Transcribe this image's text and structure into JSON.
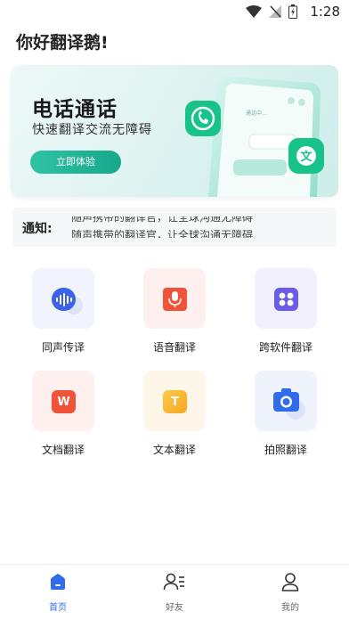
{
  "status_bar": {
    "time": "1:28"
  },
  "header": {
    "greeting": "你好翻译鹅!"
  },
  "banner": {
    "title": "电话通话",
    "subtitle": "快速翻译交流无障碍",
    "button_label": "立即体验",
    "chat_text": "通话中...",
    "badge_letter": "文"
  },
  "notice": {
    "label": "通知:",
    "line1": "随声携带的翻译官，让全球沟通无障碍",
    "line2": "随声携带的翻译官，让全球沟通无障碍"
  },
  "features": [
    {
      "label": "同声传译",
      "icon": "soundwave-icon",
      "color": "#3a63e8"
    },
    {
      "label": "语音翻译",
      "icon": "microphone-icon",
      "color": "#f0523a"
    },
    {
      "label": "跨软件翻译",
      "icon": "apps-grid-icon",
      "color": "#6a5ce8"
    },
    {
      "label": "文档翻译",
      "icon": "document-w-icon",
      "glyph": "W",
      "color": "#f0523a"
    },
    {
      "label": "文本翻译",
      "icon": "text-t-icon",
      "glyph": "T",
      "color": "#f5a623"
    },
    {
      "label": "拍照翻译",
      "icon": "camera-icon",
      "color": "#2f6bea"
    }
  ],
  "tabbar": {
    "active_color": "#2f6bea",
    "items": [
      {
        "label": "首页",
        "icon": "home-icon",
        "active": true
      },
      {
        "label": "好友",
        "icon": "friends-icon",
        "active": false
      },
      {
        "label": "我的",
        "icon": "profile-icon",
        "active": false
      }
    ]
  }
}
